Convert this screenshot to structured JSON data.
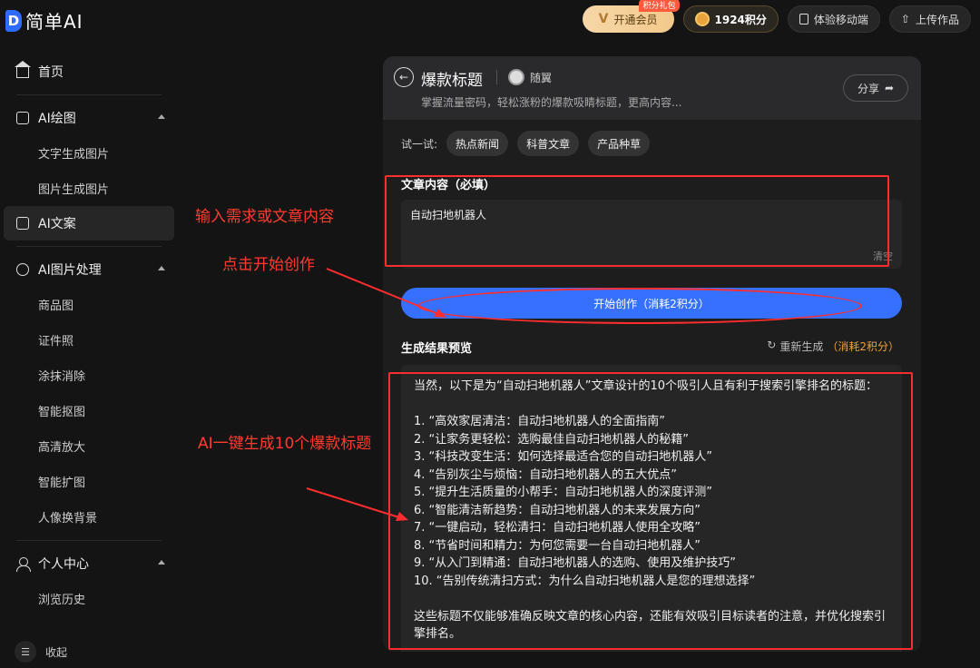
{
  "topbar": {
    "logo_letter": "D",
    "logo_text": "简单AI",
    "vip_label": "开通会员",
    "vip_tag": "积分礼包",
    "points_label": "1924积分",
    "mobile_label": "体验移动端",
    "upload_label": "上传作品"
  },
  "sidebar": {
    "home": "首页",
    "ai_draw": "AI绘图",
    "text_to_image": "文字生成图片",
    "image_to_image": "图片生成图片",
    "ai_copy": "AI文案",
    "ai_image_process": "AI图片处理",
    "sub_items": [
      "商品图",
      "证件照",
      "涂抹消除",
      "智能抠图",
      "高清放大",
      "智能扩图",
      "人像换背景"
    ],
    "personal_center": "个人中心",
    "history": "浏览历史",
    "collapse": "收起"
  },
  "annotations": {
    "input_hint": "输入需求或文章内容",
    "click_hint": "点击开始创作",
    "generate_hint": "AI一键生成10个爆款标题"
  },
  "panel": {
    "title": "爆款标题",
    "author": "随翼",
    "description": "掌握流量密码，轻松涨粉的爆款吸睛标题，更高内容...",
    "share": "分享",
    "try_label": "试一试:",
    "chips": [
      "热点新闻",
      "科普文章",
      "产品种草"
    ],
    "content_label": "文章内容（必填）",
    "content_value": "自动扫地机器人",
    "clear": "清空",
    "start_button": "开始创作（消耗2积分）",
    "result_label": "生成结果预览",
    "regen_label": "重新生成",
    "regen_cost": "（消耗2积分）",
    "result_intro": "当然，以下是为“自动扫地机器人”文章设计的10个吸引人且有利于搜索引擎排名的标题：",
    "result_items": [
      "1.  “高效家居清洁：自动扫地机器人的全面指南”",
      "2.  “让家务更轻松：选购最佳自动扫地机器人的秘籍”",
      "3.  “科技改变生活：如何选择最适合您的自动扫地机器人”",
      "4.  “告别灰尘与烦恼：自动扫地机器人的五大优点”",
      "5.  “提升生活质量的小帮手：自动扫地机器人的深度评测”",
      "6.  “智能清洁新趋势：自动扫地机器人的未来发展方向”",
      "7.  “一键启动，轻松清扫：自动扫地机器人使用全攻略”",
      "8.  “节省时间和精力：为何您需要一台自动扫地机器人”",
      "9.  “从入门到精通：自动扫地机器人的选购、使用及维护技巧”",
      "10.  “告别传统清扫方式：为什么自动扫地机器人是您的理想选择”"
    ],
    "result_outro": "这些标题不仅能够准确反映文章的核心内容，还能有效吸引目标读者的注意，并优化搜索引擎排名。"
  },
  "colors": {
    "accent": "#3670ff",
    "annotation": "#ff2d2d",
    "points": "#e8a33a"
  }
}
